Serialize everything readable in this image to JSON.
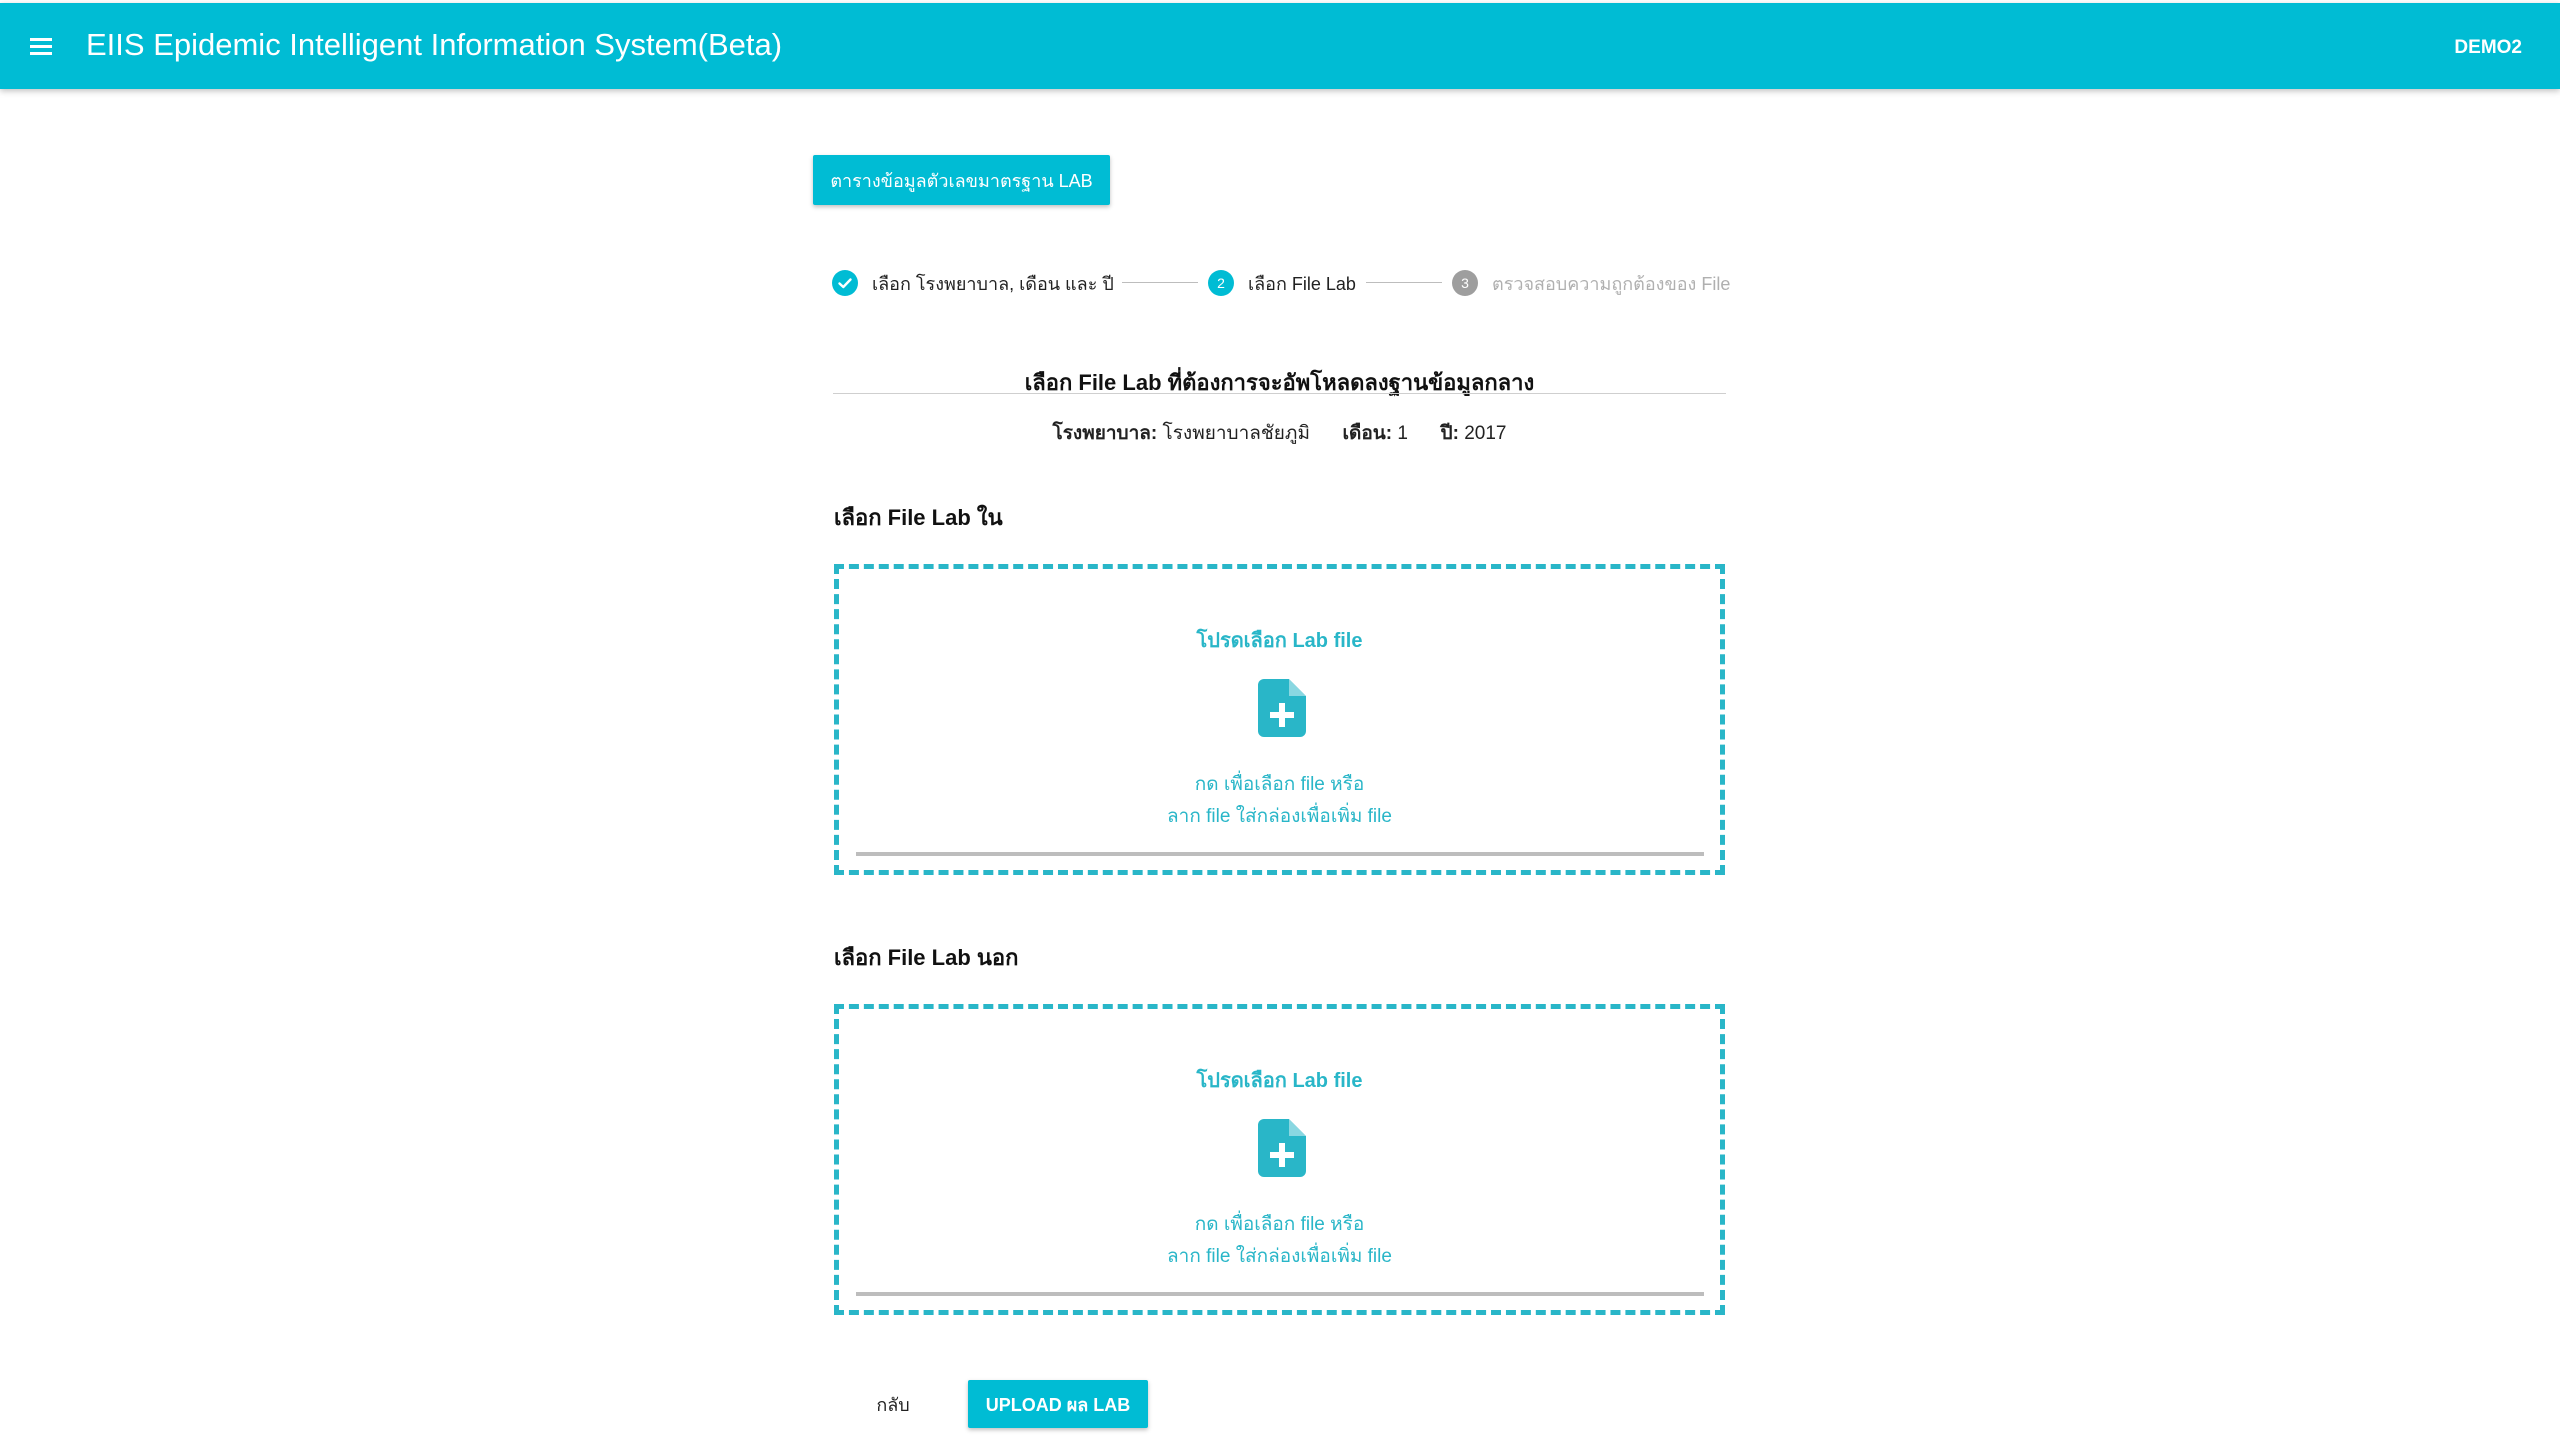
{
  "app": {
    "title": "EIIS Epidemic Intelligent Information System(Beta)",
    "user": "DEMO2",
    "menu_icon": "hamburger-menu-icon"
  },
  "toolbar": {
    "std_table_label": "ตารางข้อมูลตัวเลขมาตรฐาน LAB"
  },
  "stepper": {
    "steps": [
      {
        "number": "1",
        "label": "เลือก โรงพยาบาล, เดือน และ ปี",
        "state": "completed",
        "icon": "check-icon"
      },
      {
        "number": "2",
        "label": "เลือก File Lab",
        "state": "active"
      },
      {
        "number": "3",
        "label": "ตรวจสอบความถูกต้องของ File",
        "state": "inactive"
      }
    ]
  },
  "header": {
    "heading": "เลือก File Lab ที่ต้องการจะอัพโหลดลงฐานข้อมูลกลาง"
  },
  "info": {
    "hospital_label": "โรงพยาบาล:",
    "hospital_value": "โรงพยาบาลชัยภูมิ",
    "month_label": "เดือน:",
    "month_value": "1",
    "year_label": "ปี:",
    "year_value": "2017"
  },
  "sections": {
    "inpatient": {
      "title": "เลือก File Lab ใน",
      "dropzone_title": "โปรดเลือก Lab file",
      "hint_line1": "กด เพื่อเลือก file หรือ",
      "hint_line2": "ลาก file ใส่กล่องเพื่อเพิ่ม file",
      "icon": "file-add-icon"
    },
    "outpatient": {
      "title": "เลือก File Lab นอก",
      "dropzone_title": "โปรดเลือก Lab file",
      "hint_line1": "กด เพื่อเลือก file หรือ",
      "hint_line2": "ลาก file ใส่กล่องเพื่อเพิ่ม file",
      "icon": "file-add-icon"
    }
  },
  "footer": {
    "back_label": "กลับ",
    "upload_label": "UPLOAD ผล LAB"
  },
  "colors": {
    "primary": "#00bcd4",
    "dropzone": "#29b6c8",
    "step_inactive": "#9e9e9e"
  }
}
